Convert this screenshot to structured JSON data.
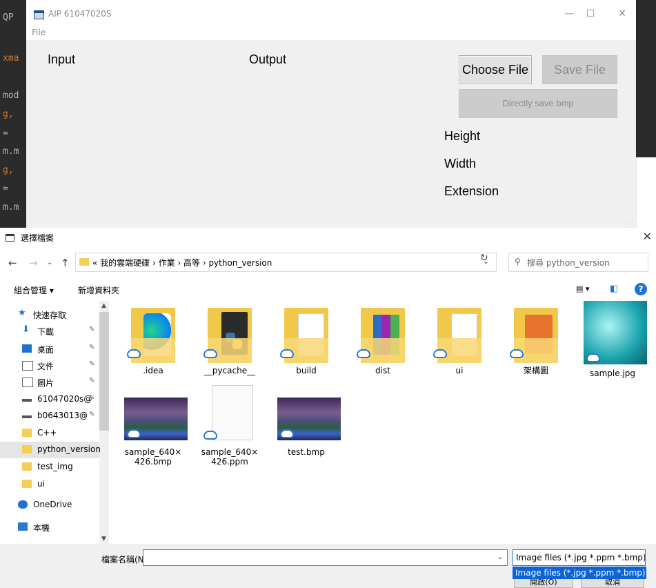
{
  "ide": {
    "lines": [
      "QP",
      "xma",
      "mod",
      " g,",
      " =",
      "m.m",
      " g,",
      " =",
      "m.m"
    ]
  },
  "app": {
    "title": "AIP 61047020S",
    "menu_file": "File",
    "input_label": "Input",
    "output_label": "Output",
    "choose_file": "Choose File",
    "save_file": "Save File",
    "direct_save": "Directly save bmp",
    "height_label": "Height",
    "width_label": "Width",
    "extension_label": "Extension",
    "minimize": "—",
    "maximize": "☐",
    "close": "✕"
  },
  "dialog": {
    "title": "選擇檔案",
    "breadcrumb": "« 我的雲端硬碟 › 作業 › 高等 › python_version",
    "search_placeholder": "搜尋 python_version",
    "organize": "組合管理 ▾",
    "new_folder": "新增資料夾",
    "sidebar": [
      {
        "label": "快速存取",
        "icon": "star-icon",
        "pin": false
      },
      {
        "label": "下載",
        "icon": "download-icon",
        "pin": true
      },
      {
        "label": "桌面",
        "icon": "desktop-icon",
        "pin": true
      },
      {
        "label": "文件",
        "icon": "documents-icon",
        "pin": true
      },
      {
        "label": "圖片",
        "icon": "pictures-icon",
        "pin": true
      },
      {
        "label": "61047020s@",
        "icon": "drive-icon",
        "pin": true
      },
      {
        "label": "b0643013@",
        "icon": "drive-icon",
        "pin": true
      },
      {
        "label": "C++",
        "icon": "folder-icon",
        "pin": false
      },
      {
        "label": "python_version",
        "icon": "folder-icon",
        "pin": false,
        "selected": true
      },
      {
        "label": "test_img",
        "icon": "folder-icon",
        "pin": false
      },
      {
        "label": "ui",
        "icon": "folder-icon",
        "pin": false
      },
      {
        "label": "OneDrive",
        "icon": "onedrive-icon",
        "pin": false
      },
      {
        "label": "本機",
        "icon": "computer-icon",
        "pin": false
      }
    ],
    "files": [
      {
        "name": ".idea",
        "kind": "folder",
        "overlay": "pycharm"
      },
      {
        "name": "__pycache__",
        "kind": "folder",
        "overlay": "python"
      },
      {
        "name": "build",
        "kind": "folder",
        "overlay": "doc"
      },
      {
        "name": "dist",
        "kind": "folder",
        "overlay": "winrar"
      },
      {
        "name": "ui",
        "kind": "folder",
        "overlay": "doc"
      },
      {
        "name": "架構圖",
        "kind": "folder",
        "overlay": "diagram"
      },
      {
        "name": "sample.jpg",
        "kind": "image",
        "overlay": "butterfly"
      },
      {
        "name": "sample_640×\n426.bmp",
        "kind": "image",
        "overlay": "stars"
      },
      {
        "name": "sample_640×\n426.ppm",
        "kind": "blank",
        "overlay": "none"
      },
      {
        "name": "test.bmp",
        "kind": "image",
        "overlay": "stars"
      }
    ],
    "filename_label": "檔案名稱(N):",
    "filename_value": "",
    "filter_value": "Image files (*.jpg *.ppm *.bmp)",
    "filter_option": "Image files (*.jpg *.ppm *.bmp)",
    "open_button": "開啟(O)",
    "cancel_button": "取消"
  },
  "colors": {
    "accent": "#0a64d8",
    "folder": "#f5cd5b",
    "cloud": "#2b79c9"
  }
}
